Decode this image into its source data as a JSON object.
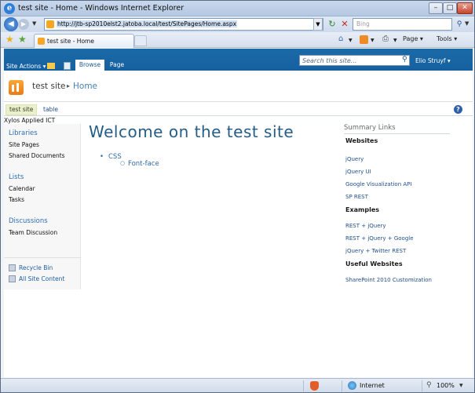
{
  "browser": {
    "title": "test site - Home - Windows Internet Explorer",
    "controls": {
      "minimize": "–",
      "maximize": "□",
      "close": "✕"
    },
    "address": "http://jtb-sp2010elst2.jatoba.local/test/SitePages/Home.aspx",
    "search_placeholder": "Bing",
    "tab_title": "test site - Home",
    "commands": {
      "page": "Page ▾",
      "tools": "Tools ▾"
    },
    "status": {
      "zone": "Internet",
      "zoom": "100%"
    }
  },
  "ribbon": {
    "site_actions": "Site Actions ▾",
    "tabs": [
      {
        "label": "Browse"
      },
      {
        "label": "Page"
      }
    ],
    "search_placeholder": "Search this site...",
    "user": "Elio Struyf ▾"
  },
  "title_area": {
    "site": "test site",
    "separator": "▸",
    "page": "Home"
  },
  "top_nav": {
    "active": "test site",
    "link": "table",
    "help": "?"
  },
  "company": "Xylos Applied ICT",
  "quick_launch": {
    "sections": [
      {
        "heading": "Libraries",
        "items": [
          "Site Pages",
          "Shared Documents"
        ]
      },
      {
        "heading": "Lists",
        "items": [
          "Calendar",
          "Tasks"
        ]
      },
      {
        "heading": "Discussions",
        "items": [
          "Team Discussion"
        ]
      }
    ],
    "recycle_bin": "Recycle Bin",
    "all_content": "All Site Content"
  },
  "main": {
    "title": "Welcome on the test site",
    "bullets": [
      {
        "label": "CSS",
        "children": [
          "Font-face"
        ]
      }
    ]
  },
  "summary_links": {
    "title": "Summary Links",
    "groups": [
      {
        "heading": "Websites",
        "links": [
          "jQuery",
          "jQuery UI",
          "Google Visualization API",
          "SP REST"
        ]
      },
      {
        "heading": "Examples",
        "links": [
          "REST + jQuery",
          "REST + jQuery + Google",
          "jQuery + Twitter REST"
        ]
      },
      {
        "heading": "Useful Websites",
        "links": [
          "SharePoint 2010 Customization"
        ]
      }
    ]
  }
}
